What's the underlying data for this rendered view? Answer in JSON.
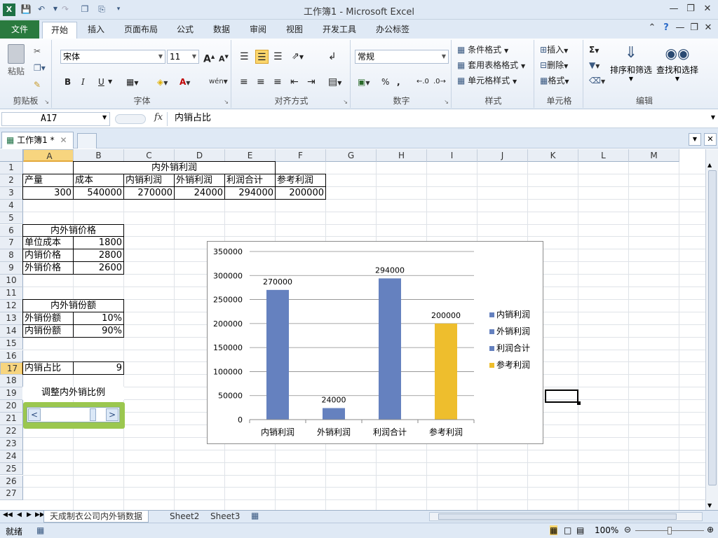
{
  "app": {
    "title": "工作簿1 - Microsoft Excel",
    "icon_letter": "X"
  },
  "ribbon_tabs": [
    "文件",
    "开始",
    "插入",
    "页面布局",
    "公式",
    "数据",
    "审阅",
    "视图",
    "开发工具",
    "办公标签"
  ],
  "ribbon": {
    "clipboard": {
      "paste": "粘贴",
      "label": "剪贴板"
    },
    "font": {
      "name": "宋体",
      "size": "11",
      "label": "字体",
      "bold": "B",
      "italic": "I",
      "underline": "U",
      "grow": "A",
      "shrink": "A",
      "wen": "wén"
    },
    "alignment": {
      "label": "对齐方式"
    },
    "number": {
      "format": "常规",
      "label": "数字",
      "percent": "%",
      "comma": ","
    },
    "styles": {
      "conditional": "条件格式",
      "table": "套用表格格式",
      "cell": "单元格样式",
      "label": "样式"
    },
    "cells": {
      "insert": "插入",
      "delete": "删除",
      "format": "格式",
      "label": "单元格"
    },
    "editing": {
      "sort": "排序和筛选",
      "find": "查找和选择",
      "sum": "Σ",
      "label": "编辑"
    }
  },
  "formula_bar": {
    "name_box": "A17",
    "fx": "fx",
    "content": "内销占比"
  },
  "doc_tab": {
    "label": "工作簿1 *"
  },
  "columns": [
    "A",
    "B",
    "C",
    "D",
    "E",
    "F",
    "G",
    "H",
    "I",
    "J",
    "K",
    "L",
    "M"
  ],
  "selected_column": "A",
  "selected_row": "17",
  "rows": [
    "1",
    "2",
    "3",
    "4",
    "5",
    "6",
    "7",
    "8",
    "9",
    "10",
    "11",
    "12",
    "13",
    "14",
    "15",
    "16",
    "17",
    "18",
    "19",
    "20",
    "21",
    "22",
    "23",
    "24",
    "25",
    "26",
    "27"
  ],
  "cells": {
    "C1": "内外销利润",
    "A2": "产量",
    "B2": "成本",
    "C2": "内销利润",
    "D2": "外销利润",
    "E2": "利润合计",
    "F2": "参考利润",
    "A3": "300",
    "B3": "540000",
    "C3": "270000",
    "D3": "24000",
    "E3": "294000",
    "F3": "200000",
    "A6": "内外销价格",
    "A7": "单位成本",
    "B7": "1800",
    "A8": "内销价格",
    "B8": "2800",
    "A9": "外销价格",
    "B9": "2600",
    "A12": "内外销份额",
    "A13": "外销份额",
    "B13": "10%",
    "A14": "内销份额",
    "B14": "90%",
    "A17": "内销占比",
    "B17": "9",
    "A19": "调整内外销比例"
  },
  "scrollbar_control": {
    "left": "<",
    "right": ">",
    "position": 0.8
  },
  "chart_data": {
    "type": "bar",
    "categories": [
      "内销利润",
      "外销利润",
      "利润合计",
      "参考利润"
    ],
    "values": [
      270000,
      24000,
      294000,
      200000
    ],
    "data_labels": [
      "270000",
      "24000",
      "294000",
      "200000"
    ],
    "colors": [
      "#6581bf",
      "#6581bf",
      "#6581bf",
      "#eebe2d"
    ],
    "yticks": [
      "0",
      "50000",
      "100000",
      "150000",
      "200000",
      "250000",
      "300000",
      "350000"
    ],
    "ylim": [
      0,
      350000
    ],
    "legend": [
      "内销利润",
      "外销利润",
      "利润合计",
      "参考利润"
    ],
    "legend_position": "right",
    "grid": true
  },
  "sheet_tabs": [
    "天成制衣公司内外销数据",
    "Sheet2",
    "Sheet3"
  ],
  "status": {
    "ready": "就绪",
    "zoom": "100%"
  }
}
